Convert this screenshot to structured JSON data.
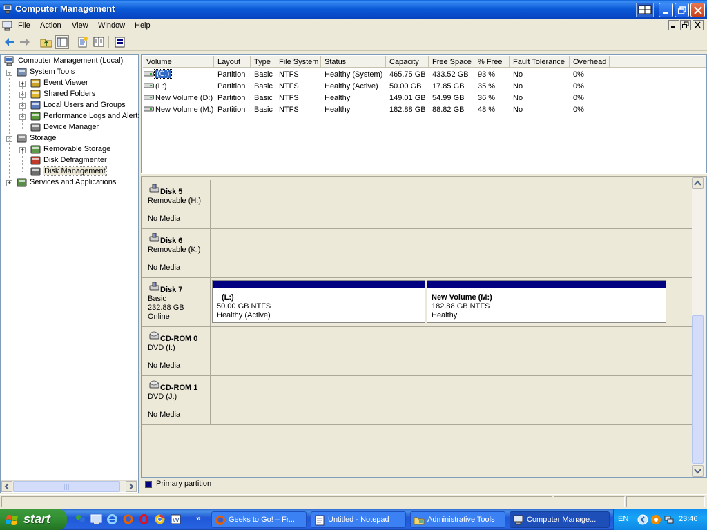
{
  "window": {
    "title": "Computer Management"
  },
  "menu": [
    "File",
    "Action",
    "View",
    "Window",
    "Help"
  ],
  "tree": {
    "root": "Computer Management (Local)",
    "items": [
      {
        "label": "System Tools",
        "level": 1,
        "expanded": true
      },
      {
        "label": "Event Viewer",
        "level": 2
      },
      {
        "label": "Shared Folders",
        "level": 2
      },
      {
        "label": "Local Users and Groups",
        "level": 2
      },
      {
        "label": "Performance Logs and Alert:",
        "level": 2
      },
      {
        "label": "Device Manager",
        "level": 2
      },
      {
        "label": "Storage",
        "level": 1,
        "expanded": true
      },
      {
        "label": "Removable Storage",
        "level": 2
      },
      {
        "label": "Disk Defragmenter",
        "level": 2
      },
      {
        "label": "Disk Management",
        "level": 2,
        "selected": true
      },
      {
        "label": "Services and Applications",
        "level": 1
      }
    ]
  },
  "volumes": {
    "columns": [
      "Volume",
      "Layout",
      "Type",
      "File System",
      "Status",
      "Capacity",
      "Free Space",
      "% Free",
      "Fault Tolerance",
      "Overhead"
    ],
    "rows": [
      [
        "(C:)",
        "Partition",
        "Basic",
        "NTFS",
        "Healthy (System)",
        "465.75 GB",
        "433.52 GB",
        "93 %",
        "No",
        "0%"
      ],
      [
        "(L:)",
        "Partition",
        "Basic",
        "NTFS",
        "Healthy (Active)",
        "50.00 GB",
        "17.85 GB",
        "35 %",
        "No",
        "0%"
      ],
      [
        "New Volume (D:)",
        "Partition",
        "Basic",
        "NTFS",
        "Healthy",
        "149.01 GB",
        "54.99 GB",
        "36 %",
        "No",
        "0%"
      ],
      [
        "New Volume (M:)",
        "Partition",
        "Basic",
        "NTFS",
        "Healthy",
        "182.88 GB",
        "88.82 GB",
        "48 %",
        "No",
        "0%"
      ]
    ]
  },
  "disks": [
    {
      "name": "Disk 5",
      "line1": "Removable (H:)",
      "line2": "",
      "line3": "No Media"
    },
    {
      "name": "Disk 6",
      "line1": "Removable (K:)",
      "line2": "",
      "line3": "No Media"
    },
    {
      "name": "Disk 7",
      "line1": "Basic",
      "line2": "232.88 GB",
      "line3": "Online",
      "partitions": [
        {
          "title": "(L:)",
          "size": "50.00 GB NTFS",
          "status": "Healthy (Active)"
        },
        {
          "title": "New Volume  (M:)",
          "size": "182.88 GB NTFS",
          "status": "Healthy"
        }
      ]
    },
    {
      "name": "CD-ROM 0",
      "line1": "DVD (I:)",
      "line2": "",
      "line3": "No Media"
    },
    {
      "name": "CD-ROM 1",
      "line1": "DVD (J:)",
      "line2": "",
      "line3": "No Media"
    }
  ],
  "legend": {
    "primary": "Primary partition",
    "color": "#000080"
  },
  "taskbar": {
    "start": "start",
    "tasks": [
      "Geeks to Go! – Fr...",
      "Untitled - Notepad",
      "Administrative Tools",
      "Computer Manage..."
    ],
    "lang": "EN",
    "clock": "23:46"
  }
}
